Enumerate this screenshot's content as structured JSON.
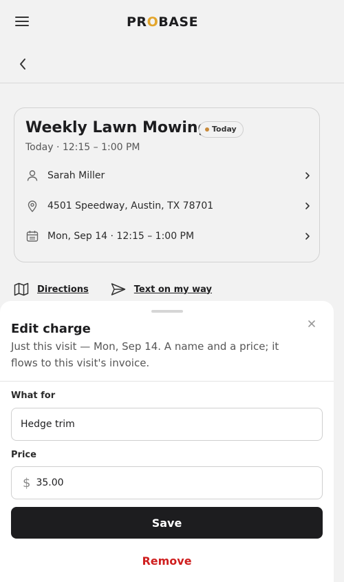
{
  "header": {
    "logo_text": "PROBASE"
  },
  "visit": {
    "title": "Weekly Lawn Mowing",
    "badge": "Today",
    "subtitle": "Today · 12:15 – 1:00 PM",
    "customer": "Sarah Miller",
    "address": "4501 Speedway, Austin, TX 78701",
    "schedule": "Mon, Sep 14 · 12:15 – 1:00 PM"
  },
  "actions": {
    "directions": "Directions",
    "text_on_way": "Text on my way"
  },
  "sheet": {
    "title": "Edit charge",
    "description": "Just this visit — Mon, Sep 14. A name and a price; it flows to this visit's invoice.",
    "what_for_label": "What for",
    "what_for_value": "Hedge trim",
    "price_label": "Price",
    "currency": "$",
    "price_value": "35.00",
    "save_label": "Save",
    "remove_label": "Remove"
  },
  "colors": {
    "accent": "#e3a52b",
    "danger": "#cf1f1f",
    "primary": "#1d1d1f"
  }
}
